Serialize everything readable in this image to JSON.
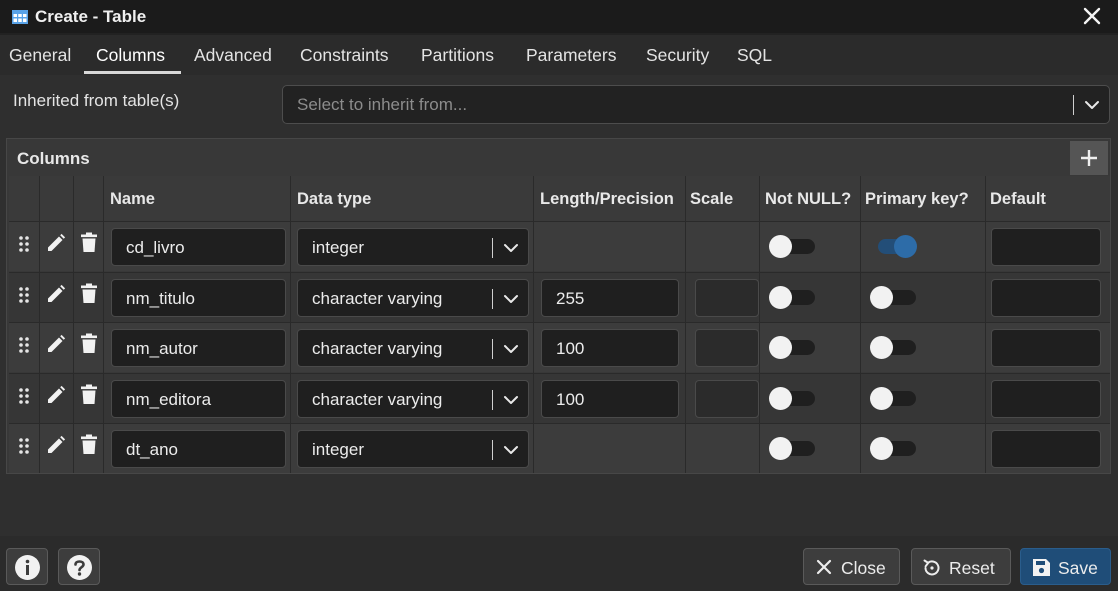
{
  "window": {
    "title": "Create - Table"
  },
  "tabs": [
    {
      "label": "General"
    },
    {
      "label": "Columns"
    },
    {
      "label": "Advanced"
    },
    {
      "label": "Constraints"
    },
    {
      "label": "Partitions"
    },
    {
      "label": "Parameters"
    },
    {
      "label": "Security"
    },
    {
      "label": "SQL"
    }
  ],
  "active_tab": "Columns",
  "inherit": {
    "label": "Inherited from table(s)",
    "placeholder": "Select to inherit from..."
  },
  "columns_panel": {
    "title": "Columns",
    "headers": {
      "name": "Name",
      "data_type": "Data type",
      "length": "Length/Precision",
      "scale": "Scale",
      "not_null": "Not NULL?",
      "primary_key": "Primary key?",
      "default": "Default"
    },
    "rows": [
      {
        "name": "cd_livro",
        "data_type": "integer",
        "length": "",
        "not_null": false,
        "primary_key": true,
        "default": ""
      },
      {
        "name": "nm_titulo",
        "data_type": "character varying",
        "length": "255",
        "not_null": false,
        "primary_key": false,
        "default": ""
      },
      {
        "name": "nm_autor",
        "data_type": "character varying",
        "length": "100",
        "not_null": false,
        "primary_key": false,
        "default": ""
      },
      {
        "name": "nm_editora",
        "data_type": "character varying",
        "length": "100",
        "not_null": false,
        "primary_key": false,
        "default": ""
      },
      {
        "name": "dt_ano",
        "data_type": "integer",
        "length": "",
        "not_null": false,
        "primary_key": false,
        "default": ""
      }
    ]
  },
  "footer": {
    "close_label": "Close",
    "reset_label": "Reset",
    "save_label": "Save"
  },
  "colors": {
    "accent": "#2d6ca8",
    "save_bg": "#1f4d78",
    "background": "#222222"
  }
}
